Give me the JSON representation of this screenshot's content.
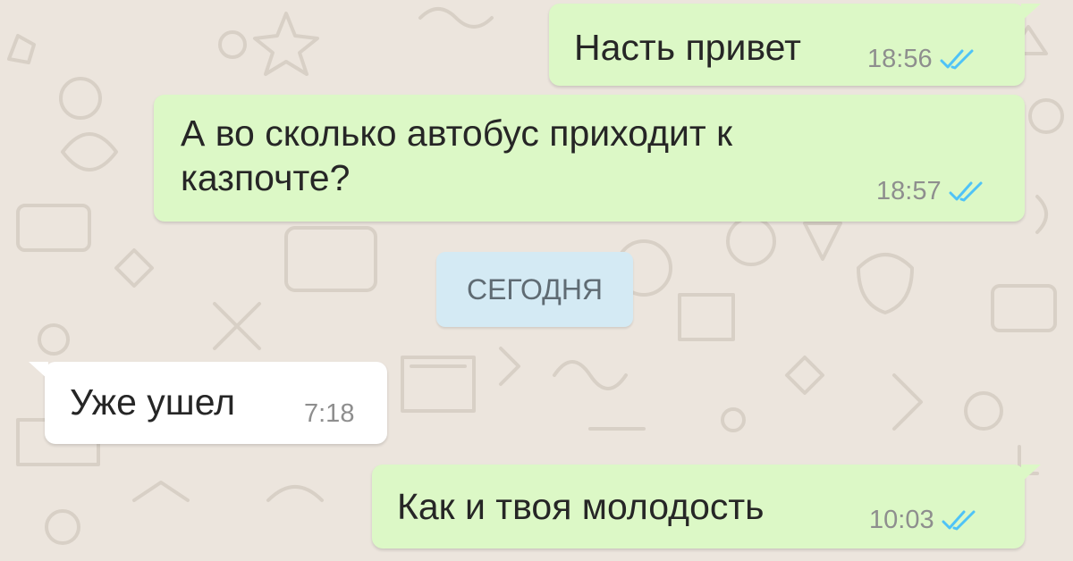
{
  "chat": {
    "messages": [
      {
        "direction": "outgoing",
        "text": "Насть привет",
        "time": "18:56",
        "status": "read"
      },
      {
        "direction": "outgoing",
        "text": "А во сколько автобус приходит к казпочте?",
        "time": "18:57",
        "status": "read"
      },
      {
        "direction": "incoming",
        "text": "Уже ушел",
        "time": "7:18"
      },
      {
        "direction": "outgoing",
        "text": "Как и твоя молодость",
        "time": "10:03",
        "status": "read"
      }
    ],
    "date_separator": "СЕГОДНЯ"
  },
  "colors": {
    "background": "#ece5dd",
    "outgoing_bubble": "#dcf8c6",
    "incoming_bubble": "#ffffff",
    "read_ticks": "#4fc3f7",
    "date_pill": "#d4eaf4"
  },
  "icons": {
    "read_status": "double-check-icon"
  }
}
